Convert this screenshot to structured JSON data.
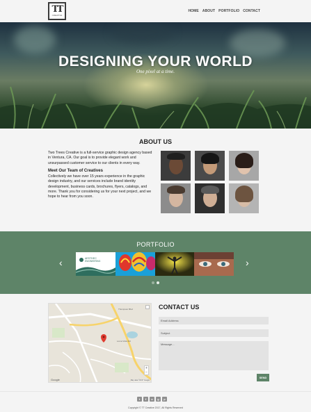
{
  "header": {
    "logo_mark": "TT",
    "logo_sub": "CREATIVE",
    "nav": [
      "HOME",
      "ABOUT",
      "PORTFOLIO",
      "CONTACT"
    ]
  },
  "hero": {
    "title": "DESIGNING YOUR WORLD",
    "subtitle": "One pixel at a time."
  },
  "about": {
    "heading": "ABOUT US",
    "intro": "Two Trees Creative is a full-service graphic design agency based in Ventura, CA. Our goal is to provide elegant work and unsurpassed customer service to our clients in every way.",
    "team_heading": "Meet Our Team of Creatives",
    "team_text": "Collectively we have over 15 years experience in the graphic design industry, and our services include brand identity development, business cards, brochures, flyers, catalogs, and more. Thank you for considering us for your next project, and we hope to hear from you soon."
  },
  "portfolio": {
    "heading": "PORTFOLIO",
    "prev_icon": "‹",
    "next_icon": "›",
    "slide1_logo": "AESTHEC",
    "slide1_sub": "ENGINEERING"
  },
  "contact": {
    "heading": "CONTACT US",
    "email_placeholder": "Email Address",
    "subject_placeholder": "Subject",
    "message_placeholder": "Message...",
    "send_label": "SEND",
    "map_google": "Google",
    "map_footer": "Map data ©2017 Google",
    "map_label_1": "Thompson Blvd",
    "map_label_2": "Loma Vista Rd",
    "map_zoom_in": "+",
    "map_zoom_out": "−"
  },
  "footer": {
    "social_icons": [
      "twitter-icon",
      "facebook-icon",
      "instagram-icon",
      "google-plus-icon",
      "pinterest-icon"
    ],
    "social_glyphs": [
      "t",
      "f",
      "o",
      "g",
      "p"
    ],
    "copyright": "Copyright © TT Creative 2017, All Rights Reserved"
  },
  "colors": {
    "accent": "#5e8468",
    "background": "#f4f4f4",
    "field": "#e3e3e3"
  }
}
